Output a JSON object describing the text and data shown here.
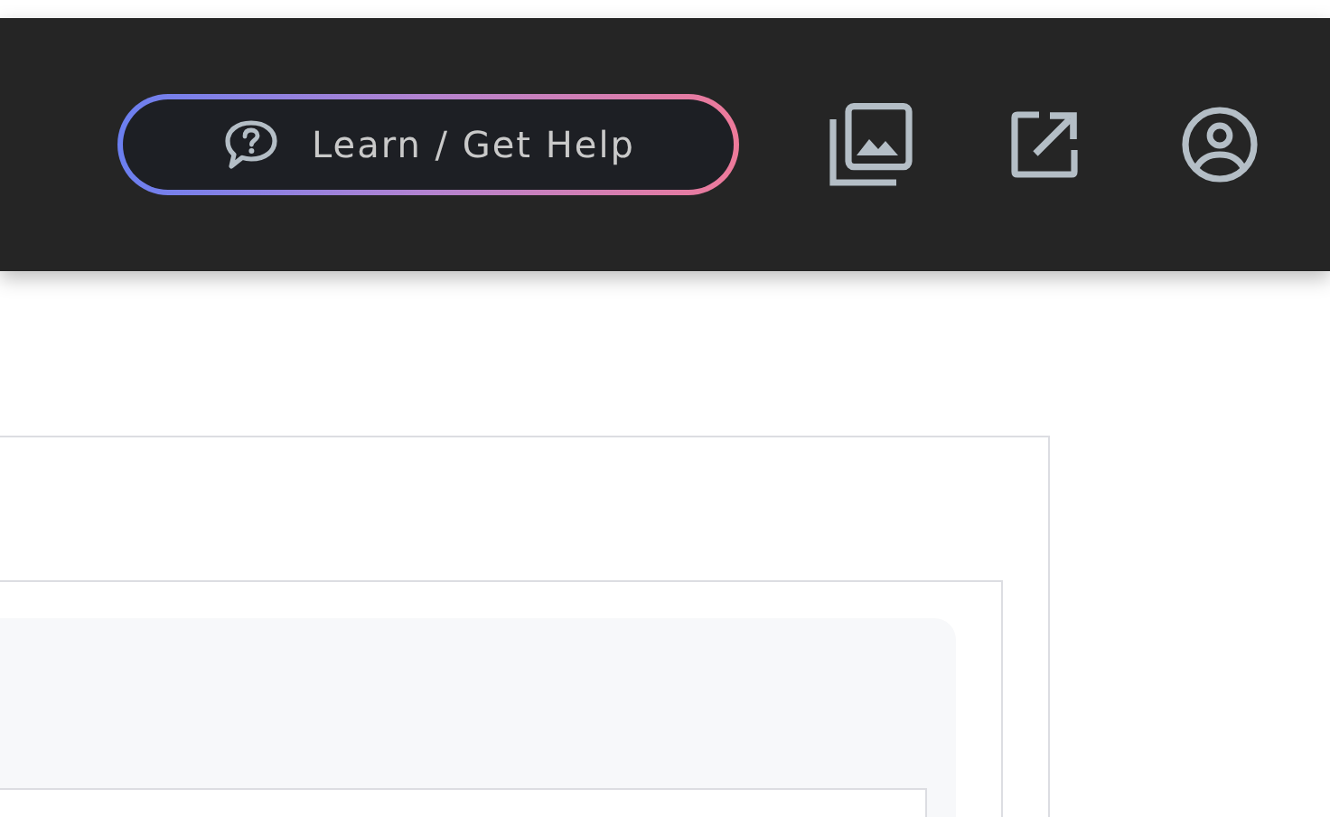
{
  "header": {
    "help_button": {
      "label": "Learn / Get Help"
    }
  }
}
